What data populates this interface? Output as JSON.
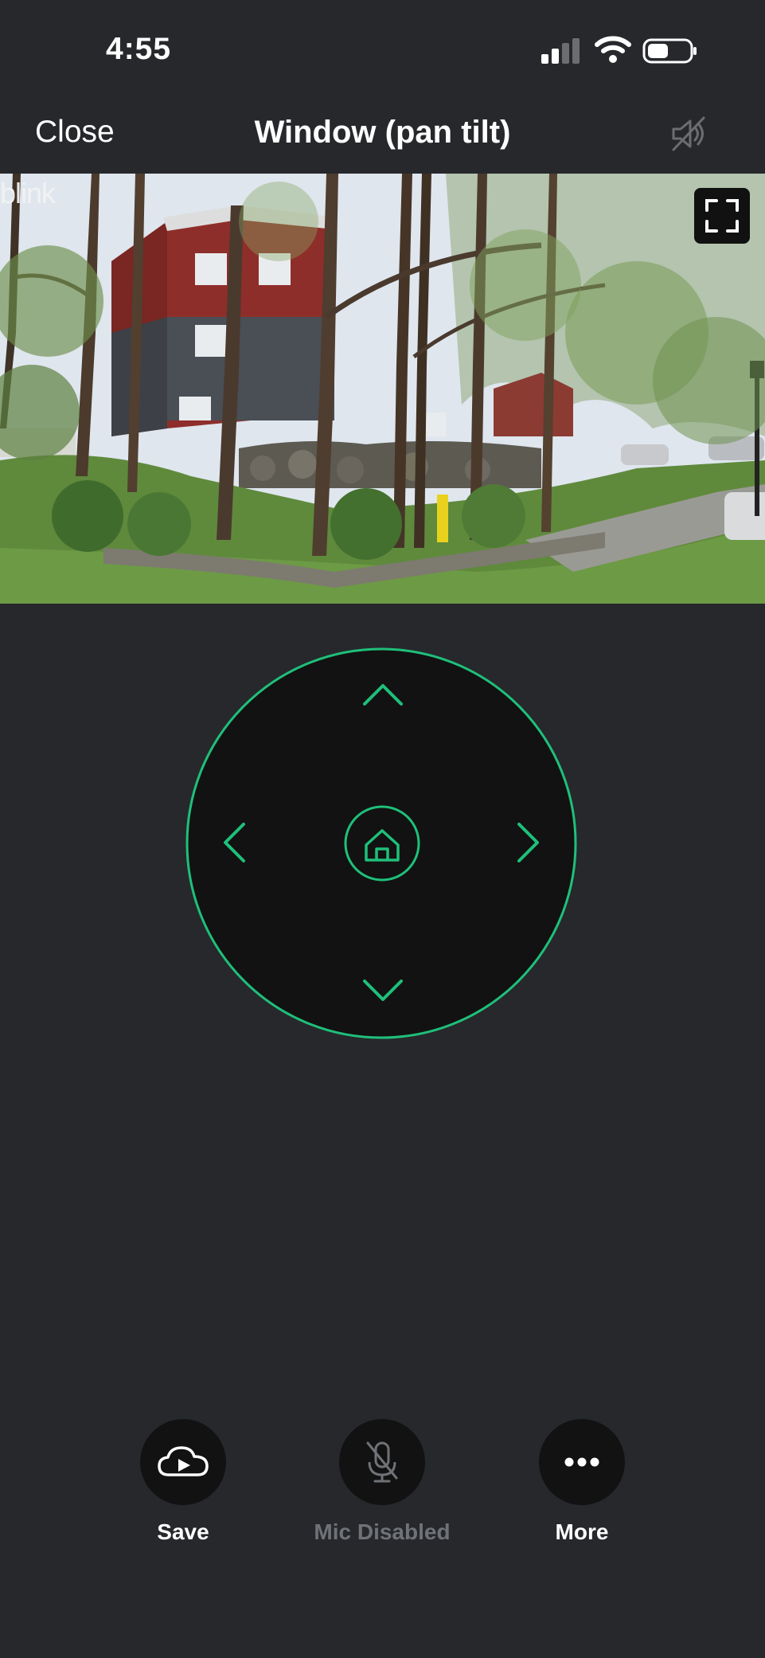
{
  "status_bar": {
    "time": "4:55",
    "signal_icon": "cellular-signal-icon",
    "wifi_icon": "wifi-icon",
    "battery_icon": "battery-icon",
    "battery_level": 0.5
  },
  "nav": {
    "close_label": "Close",
    "title": "Window (pan tilt)",
    "speaker_icon": "speaker-muted-icon"
  },
  "video": {
    "watermark": "blink",
    "fullscreen_icon": "fullscreen-icon"
  },
  "ptz": {
    "accent_color": "#1fc07a",
    "up_icon": "chevron-up-icon",
    "down_icon": "chevron-down-icon",
    "left_icon": "chevron-left-icon",
    "right_icon": "chevron-right-icon",
    "home_icon": "home-icon"
  },
  "actions": [
    {
      "label": "Save",
      "icon": "cloud-play-icon",
      "enabled": true
    },
    {
      "label": "Mic Disabled",
      "icon": "microphone-off-icon",
      "enabled": false
    },
    {
      "label": "More",
      "icon": "more-dots-icon",
      "enabled": true
    }
  ],
  "colors": {
    "background": "#26282c",
    "button_bg": "#121212",
    "disabled_text": "#6f7276",
    "accent": "#1fc07a"
  }
}
